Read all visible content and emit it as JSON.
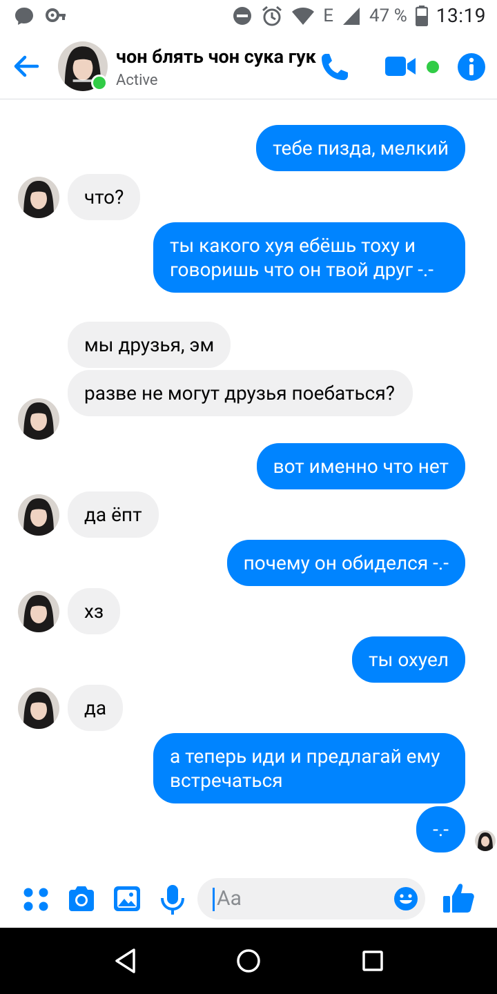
{
  "status_bar": {
    "battery_percent": "47 %",
    "network": "E",
    "time": "13:19",
    "icons": [
      "messenger-bubble-icon",
      "key-icon",
      "dnd-icon",
      "alarm-icon",
      "wifi-icon",
      "signal-icon",
      "battery-icon"
    ]
  },
  "header": {
    "contact_name": "чон блять чон сука гук",
    "status": "Active",
    "icons": [
      "back-arrow-icon",
      "phone-icon",
      "video-camera-icon",
      "info-icon"
    ],
    "accent_color": "#0084ff",
    "active_color": "#31cc46"
  },
  "messages": [
    {
      "from": "me",
      "text": "тебе пизда, мелкий"
    },
    {
      "from": "them",
      "text": "что?"
    },
    {
      "from": "me",
      "text": "ты какого хуя ебёшь тоху и говоришь что он твой друг -.-"
    },
    {
      "from": "them",
      "text": "мы друзья, эм"
    },
    {
      "from": "them",
      "text": "разве не могут друзья поебаться?"
    },
    {
      "from": "me",
      "text": "вот именно что нет"
    },
    {
      "from": "them",
      "text": "да ёпт"
    },
    {
      "from": "me",
      "text": "почему он обиделся -.-"
    },
    {
      "from": "them",
      "text": "хз"
    },
    {
      "from": "me",
      "text": "ты охуел"
    },
    {
      "from": "them",
      "text": "да"
    },
    {
      "from": "me",
      "text": "а теперь иди и предлагай ему встречаться"
    },
    {
      "from": "me",
      "text": "-.-"
    }
  ],
  "composer": {
    "placeholder": "Aa",
    "icons": [
      "more-apps-icon",
      "camera-icon",
      "gallery-icon",
      "microphone-icon",
      "emoji-icon",
      "thumbs-up-icon"
    ]
  },
  "colors": {
    "my_bubble": "#0084ff",
    "their_bubble": "#f0f0f1"
  }
}
